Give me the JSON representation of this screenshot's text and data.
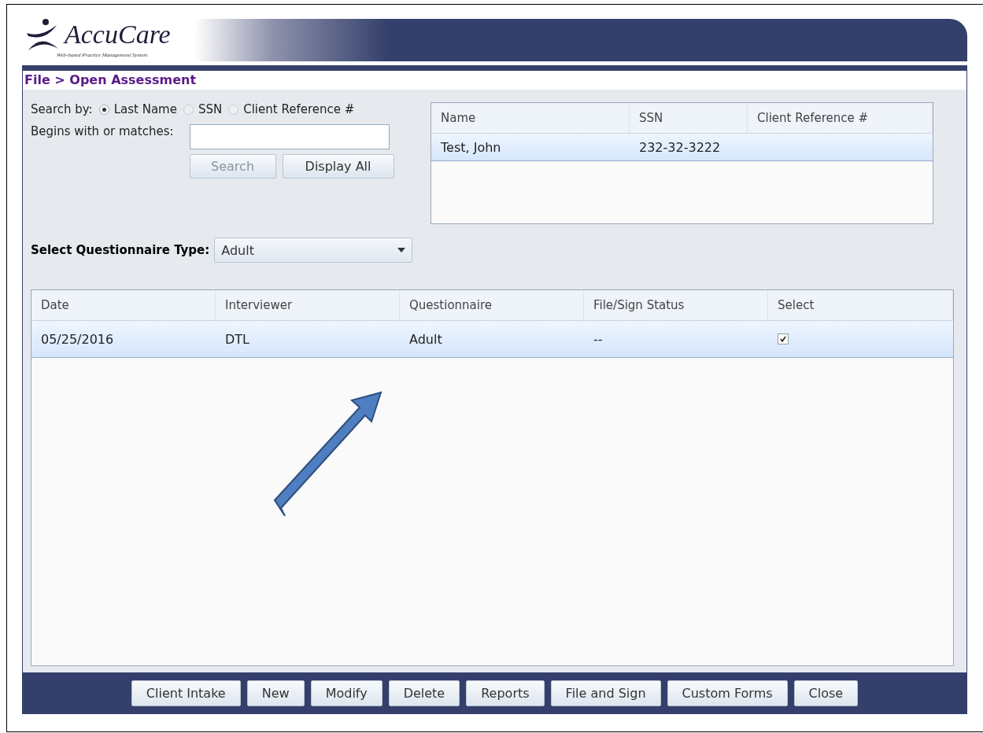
{
  "logo": {
    "name": "AccuCare",
    "tagline": "Web-based Practice Management System"
  },
  "breadcrumb": "File > Open Assessment",
  "search": {
    "label": "Search by:",
    "options": [
      {
        "label": "Last Name",
        "selected": true,
        "disabled": false
      },
      {
        "label": "SSN",
        "selected": false,
        "disabled": true
      },
      {
        "label": "Client Reference #",
        "selected": false,
        "disabled": true
      }
    ],
    "match_label": "Begins with or matches:",
    "buttons": [
      {
        "label": "Search",
        "disabled": true
      },
      {
        "label": "Display All",
        "disabled": false
      }
    ]
  },
  "clients": {
    "columns": [
      "Name",
      "SSN",
      "Client Reference #"
    ],
    "rows": [
      {
        "cells": [
          "Test, John",
          "232-32-3222",
          ""
        ],
        "selected": true
      }
    ]
  },
  "questionnaire_type": {
    "label": "Select Questionnaire Type:",
    "value": "Adult"
  },
  "assessments": {
    "columns": [
      "Date",
      "Interviewer",
      "Questionnaire",
      "File/Sign Status",
      "Select"
    ],
    "rows": [
      {
        "cells": [
          "05/25/2016",
          "DTL",
          "Adult",
          "--"
        ],
        "checked": true,
        "selected": true
      }
    ]
  },
  "footer_buttons": [
    "Client Intake",
    "New",
    "Modify",
    "Delete",
    "Reports",
    "File and Sign",
    "Custom Forms",
    "Close"
  ]
}
